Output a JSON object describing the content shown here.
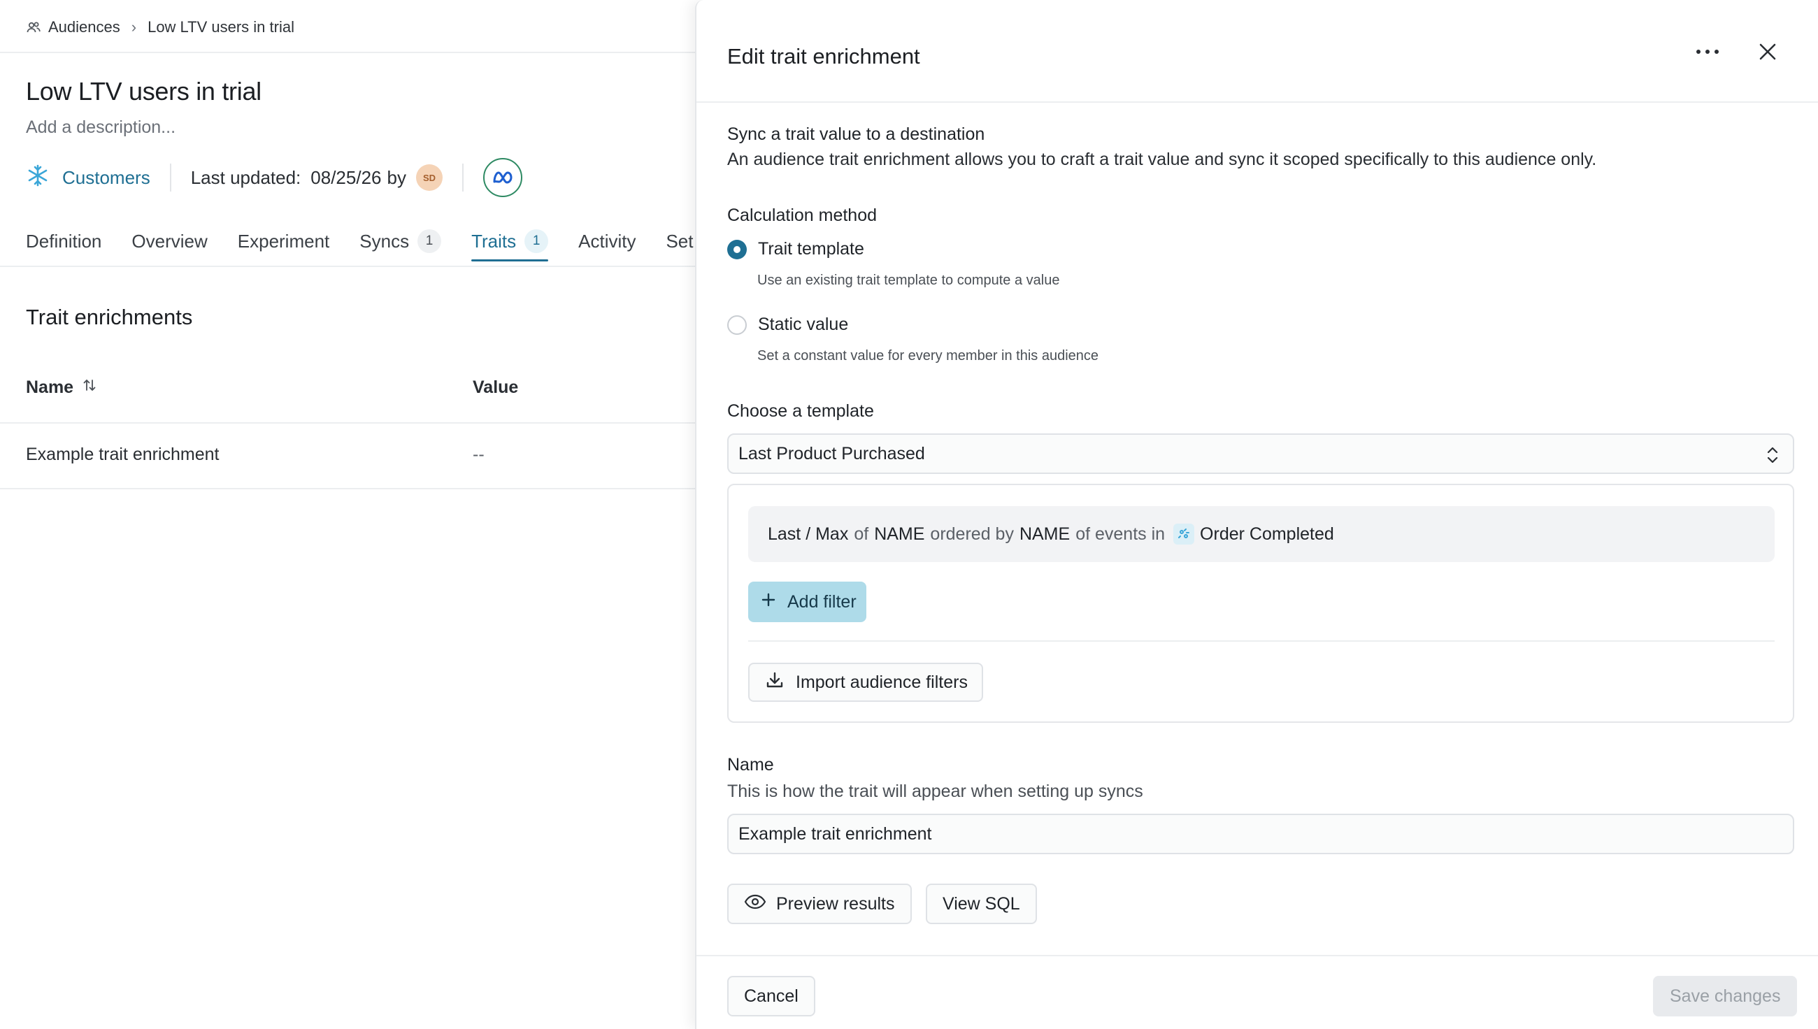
{
  "breadcrumb": {
    "parent": "Audiences",
    "current": "Low LTV users in trial"
  },
  "audience": {
    "title": "Low LTV users in trial",
    "description_placeholder": "Add a description...",
    "source_label": "Customers",
    "last_updated_label": "Last updated:",
    "last_updated_date": "08/25/26",
    "by_label": "by",
    "avatar_initials": "SD"
  },
  "tabs": [
    {
      "label": "Definition"
    },
    {
      "label": "Overview"
    },
    {
      "label": "Experiment"
    },
    {
      "label": "Syncs",
      "count": "1"
    },
    {
      "label": "Traits",
      "count": "1",
      "active": true
    },
    {
      "label": "Activity"
    },
    {
      "label": "Set"
    }
  ],
  "traits_section": {
    "title": "Trait enrichments",
    "columns": {
      "name": "Name",
      "value": "Value"
    },
    "rows": [
      {
        "name": "Example trait enrichment",
        "value": "--"
      }
    ]
  },
  "drawer": {
    "title": "Edit trait enrichment",
    "sync_heading": "Sync a trait value to a destination",
    "sync_description": "An audience trait enrichment allows you to craft a trait value and sync it scoped specifically to this audience only.",
    "calculation_label": "Calculation method",
    "options": [
      {
        "label": "Trait template",
        "help": "Use an existing trait template to compute a value",
        "checked": true
      },
      {
        "label": "Static value",
        "help": "Set a constant value for every member in this audience",
        "checked": false
      }
    ],
    "template_label": "Choose a template",
    "template_selected": "Last Product Purchased",
    "condition": {
      "agg": "Last / Max",
      "of1": "of",
      "prop1": "NAME",
      "ordered_by": "ordered by",
      "prop2": "NAME",
      "of_events_in": "of events in",
      "event": "Order Completed"
    },
    "add_filter_label": "Add filter",
    "import_filters_label": "Import audience filters",
    "name_label": "Name",
    "name_help": "This is how the trait will appear when setting up syncs",
    "name_value": "Example trait enrichment",
    "preview_label": "Preview results",
    "view_sql_label": "View SQL",
    "cancel_label": "Cancel",
    "save_label": "Save changes"
  },
  "colors": {
    "accent": "#1f6f93",
    "add_filter_bg": "#aedbe9",
    "destination_ring": "#2e8a63",
    "avatar_bg": "#f5d3b6"
  },
  "icons": {
    "breadcrumb": "users-icon",
    "source": "snowflake-icon",
    "destination": "meta-icon",
    "sort": "sort-icon",
    "more": "more-horizontal-icon",
    "close": "close-icon",
    "select": "chevron-up-down-icon",
    "event": "event-icon",
    "add": "plus-icon",
    "import": "download-icon",
    "preview": "eye-icon"
  }
}
